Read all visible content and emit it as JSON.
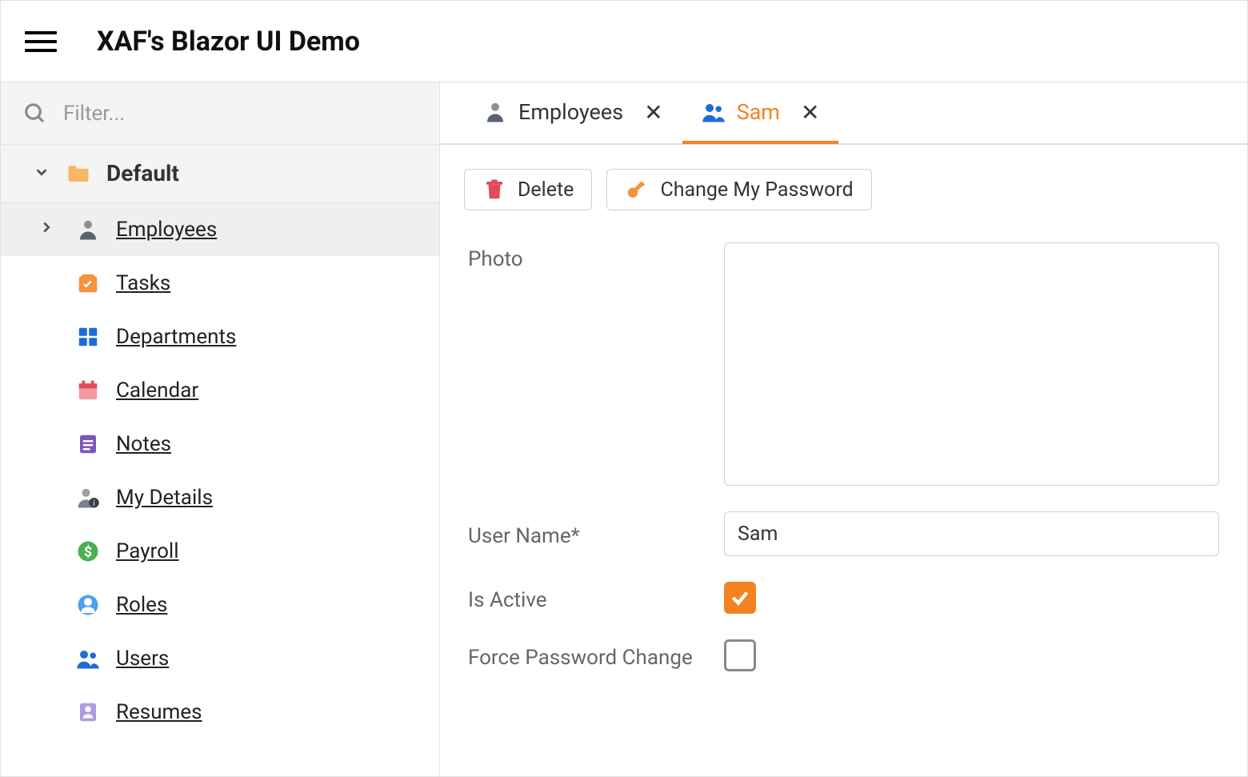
{
  "header": {
    "title": "XAF's Blazor UI Demo"
  },
  "sidebar": {
    "filter_placeholder": "Filter...",
    "group_label": "Default",
    "items": [
      {
        "label": "Employees"
      },
      {
        "label": "Tasks"
      },
      {
        "label": "Departments"
      },
      {
        "label": "Calendar"
      },
      {
        "label": "Notes"
      },
      {
        "label": "My Details"
      },
      {
        "label": "Payroll"
      },
      {
        "label": "Roles"
      },
      {
        "label": "Users"
      },
      {
        "label": "Resumes"
      }
    ]
  },
  "tabs": [
    {
      "label": "Employees"
    },
    {
      "label": "Sam"
    }
  ],
  "toolbar": {
    "delete_label": "Delete",
    "change_password_label": "Change My Password"
  },
  "form": {
    "photo_label": "Photo",
    "username_label": "User Name*",
    "username_value": "Sam",
    "is_active_label": "Is Active",
    "is_active_checked": true,
    "force_pw_label": "Force Password Change",
    "force_pw_checked": false
  }
}
